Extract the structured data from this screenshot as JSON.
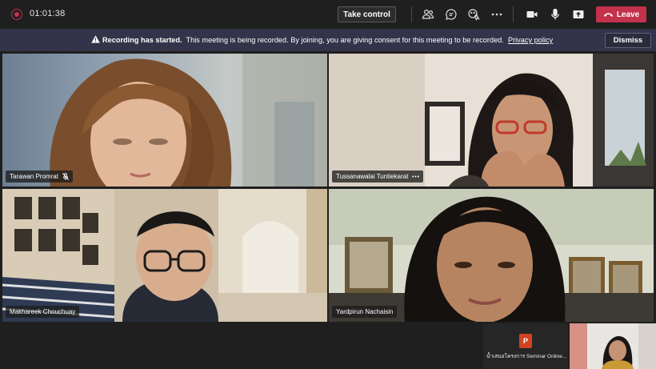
{
  "toolbar": {
    "timer": "01:01:38",
    "take_control_label": "Take control",
    "leave_label": "Leave",
    "icons": [
      "record-indicator-icon",
      "participants-icon",
      "chat-icon",
      "reactions-icon",
      "more-icon",
      "camera-icon",
      "microphone-icon",
      "share-screen-icon",
      "phone-hangup-icon"
    ]
  },
  "banner": {
    "title": "Recording has started.",
    "message": "This meeting is being recorded. By joining, you are giving consent for this meeting to be recorded.",
    "link": "Privacy policy",
    "dismiss_label": "Dismiss"
  },
  "participants": [
    {
      "name": "Tarawan Promrat",
      "muted": true
    },
    {
      "name": "Tussanawalai Tuntiekarat",
      "more": true
    },
    {
      "name": "Makhareek Chouchuay"
    },
    {
      "name": "Yardpirun Nachaisin"
    }
  ],
  "shared_content": {
    "icon": "powerpoint-icon",
    "icon_letter": "P",
    "title": "น้ำเสนอโครงการ Seminar Online..."
  },
  "colors": {
    "leave": "#c4314b",
    "banner": "#33344a",
    "toolbar": "#1f1f1f"
  }
}
